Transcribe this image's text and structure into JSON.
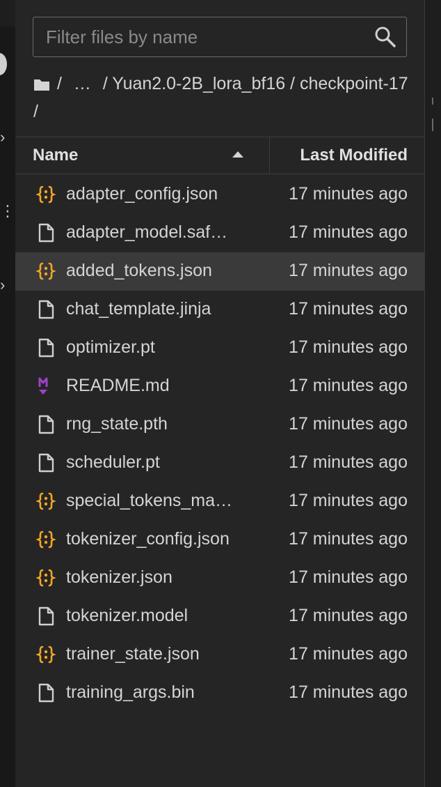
{
  "filter": {
    "placeholder": "Filter files by name"
  },
  "breadcrumb": {
    "parts": [
      "/",
      "…",
      "/ Yuan2.0-2B_lora_bf16 / checkpoint-17 /"
    ]
  },
  "columns": {
    "name": "Name",
    "modified": "Last Modified"
  },
  "colors": {
    "json": "#f5a623",
    "markdown": "#a040c8",
    "file": "#cfcfcf",
    "selected_row": "#3a3a3a"
  },
  "files": [
    {
      "name": "adapter_config.json",
      "modified": "17 minutes ago",
      "icon": "json-icon"
    },
    {
      "name": "adapter_model.saf…",
      "modified": "17 minutes ago",
      "icon": "file-icon"
    },
    {
      "name": "added_tokens.json",
      "modified": "17 minutes ago",
      "icon": "json-icon"
    },
    {
      "name": "chat_template.jinja",
      "modified": "17 minutes ago",
      "icon": "file-icon"
    },
    {
      "name": "optimizer.pt",
      "modified": "17 minutes ago",
      "icon": "file-icon"
    },
    {
      "name": "README.md",
      "modified": "17 minutes ago",
      "icon": "markdown-icon"
    },
    {
      "name": "rng_state.pth",
      "modified": "17 minutes ago",
      "icon": "file-icon"
    },
    {
      "name": "scheduler.pt",
      "modified": "17 minutes ago",
      "icon": "file-icon"
    },
    {
      "name": "special_tokens_ma…",
      "modified": "17 minutes ago",
      "icon": "json-icon"
    },
    {
      "name": "tokenizer_config.json",
      "modified": "17 minutes ago",
      "icon": "json-icon"
    },
    {
      "name": "tokenizer.json",
      "modified": "17 minutes ago",
      "icon": "json-icon"
    },
    {
      "name": "tokenizer.model",
      "modified": "17 minutes ago",
      "icon": "file-icon"
    },
    {
      "name": "trainer_state.json",
      "modified": "17 minutes ago",
      "icon": "json-icon"
    },
    {
      "name": "training_args.bin",
      "modified": "17 minutes ago",
      "icon": "file-icon"
    }
  ]
}
